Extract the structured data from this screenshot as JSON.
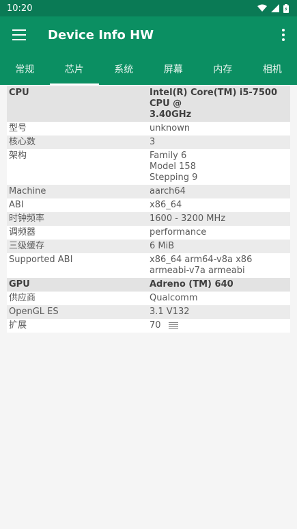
{
  "status": {
    "time": "10:20"
  },
  "app": {
    "title": "Device Info HW"
  },
  "tabs": [
    "常规",
    "芯片",
    "系统",
    "屏幕",
    "内存",
    "相机"
  ],
  "cpu": {
    "header_key": "CPU",
    "header_value": [
      "Intel(R) Core(TM) i5-7500 CPU @",
      "3.40GHz"
    ],
    "rows": [
      {
        "key": "型号",
        "value": [
          "unknown"
        ]
      },
      {
        "key": "核心数",
        "value": [
          "3"
        ]
      },
      {
        "key": "架构",
        "value": [
          "Family 6",
          "Model 158",
          "Stepping 9"
        ]
      },
      {
        "key": "Machine",
        "value": [
          "aarch64"
        ]
      },
      {
        "key": "ABI",
        "value": [
          "x86_64"
        ]
      },
      {
        "key": "时钟频率",
        "value": [
          "1600 - 3200 MHz"
        ]
      },
      {
        "key": "调频器",
        "value": [
          "performance"
        ]
      },
      {
        "key": "三级缓存",
        "value": [
          "6 MiB"
        ]
      },
      {
        "key": "Supported ABI",
        "value": [
          "x86_64 arm64-v8a x86",
          "armeabi-v7a armeabi"
        ]
      }
    ]
  },
  "gpu": {
    "header_key": "GPU",
    "header_value": "Adreno (TM) 640",
    "rows": [
      {
        "key": "供应商",
        "value": "Qualcomm"
      },
      {
        "key": "OpenGL ES",
        "value": "3.1 V132"
      },
      {
        "key": "扩展",
        "value": "70",
        "icon": "list-icon"
      }
    ]
  }
}
